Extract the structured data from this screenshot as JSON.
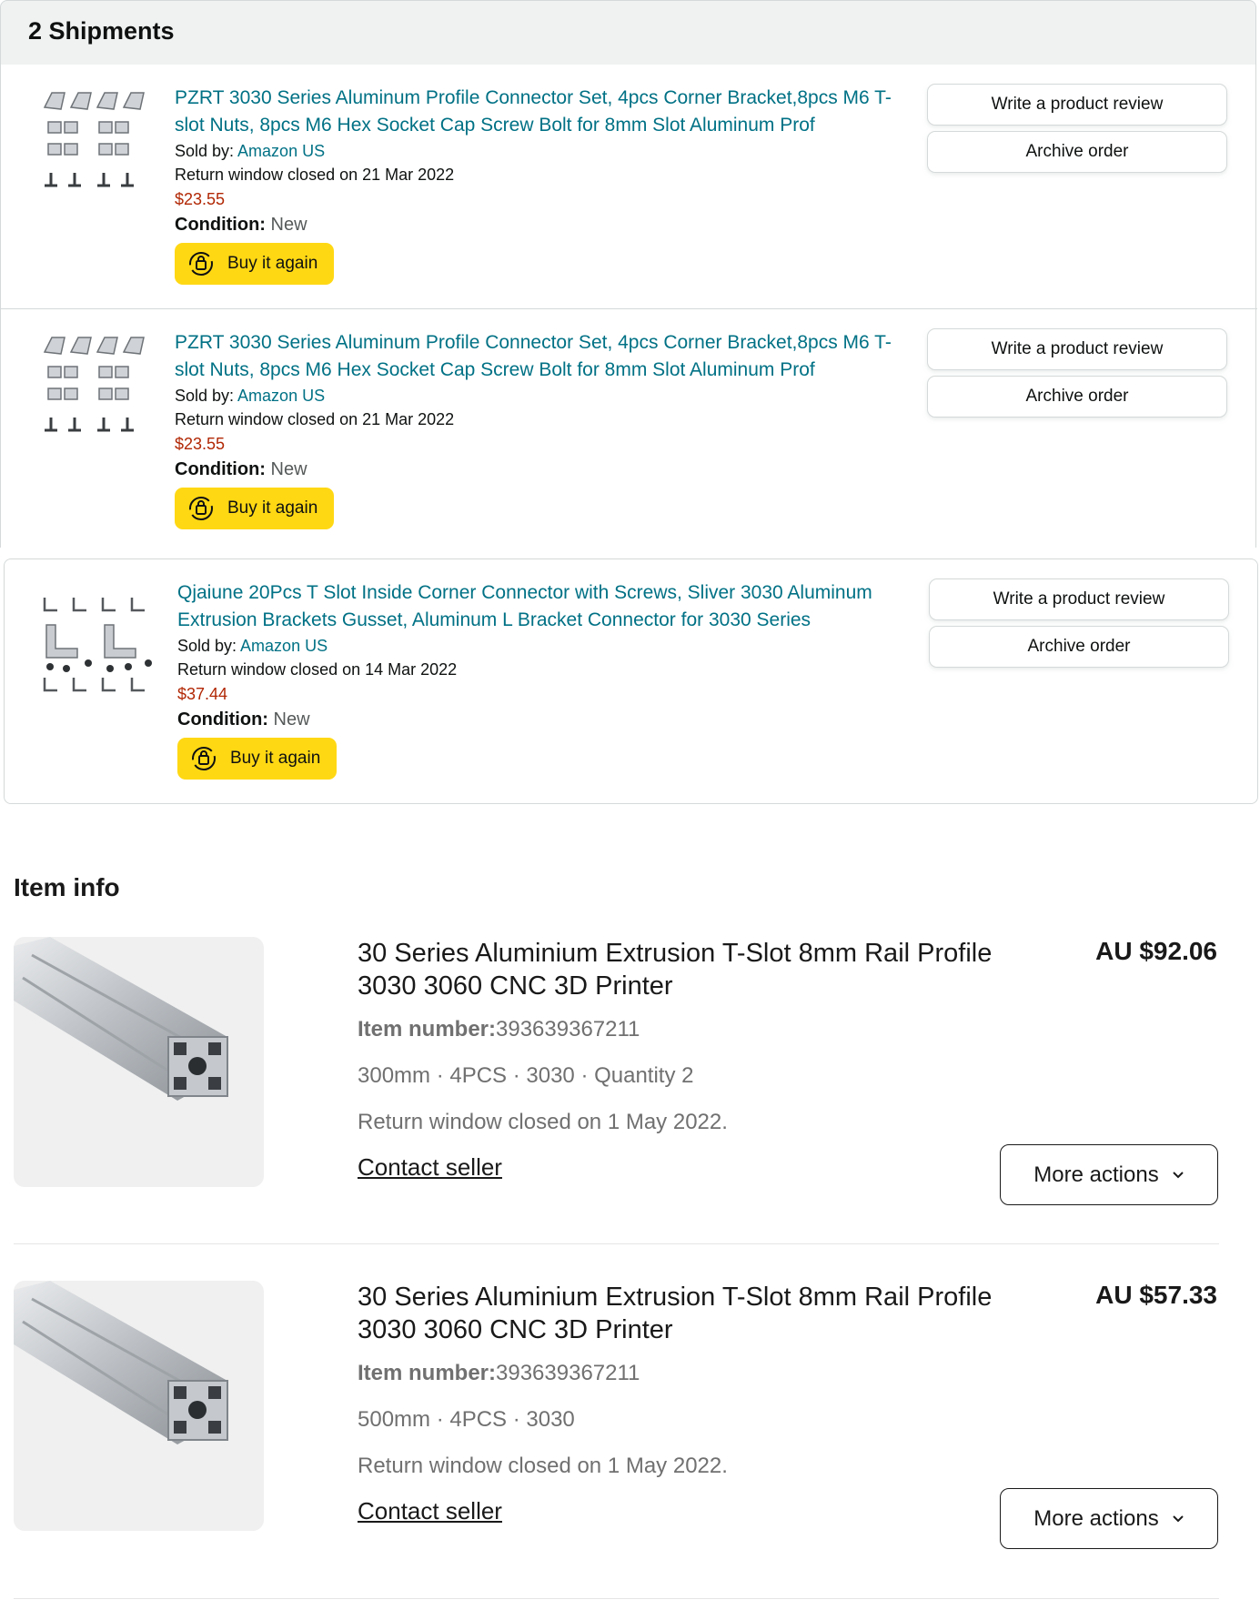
{
  "amazon": {
    "header": {
      "title": "2 Shipments"
    },
    "items": [
      {
        "title": "PZRT 3030 Series Aluminum Profile Connector Set, 4pcs Corner Bracket,8pcs M6 T-slot Nuts, 8pcs M6 Hex Socket Cap Screw Bolt for 8mm Slot Aluminum Prof",
        "sold_by_label": "Sold by: ",
        "seller": "Amazon US",
        "return_text": "Return window closed on 21 Mar 2022",
        "price": "$23.55",
        "condition_label": "Condition:",
        "condition_value": " New",
        "buy_again": "Buy it again",
        "review_button": "Write a product review",
        "archive_button": "Archive order"
      },
      {
        "title": "PZRT 3030 Series Aluminum Profile Connector Set, 4pcs Corner Bracket,8pcs M6 T-slot Nuts, 8pcs M6 Hex Socket Cap Screw Bolt for 8mm Slot Aluminum Prof",
        "sold_by_label": "Sold by: ",
        "seller": "Amazon US",
        "return_text": "Return window closed on 21 Mar 2022",
        "price": "$23.55",
        "condition_label": "Condition:",
        "condition_value": " New",
        "buy_again": "Buy it again",
        "review_button": "Write a product review",
        "archive_button": "Archive order"
      },
      {
        "title": "Qjaiune 20Pcs T Slot Inside Corner Connector with Screws, Sliver 3030 Aluminum Extrusion Brackets Gusset, Aluminum L Bracket Connector for 3030 Series",
        "sold_by_label": "Sold by: ",
        "seller": "Amazon US",
        "return_text": "Return window closed on 14 Mar 2022",
        "price": "$37.44",
        "condition_label": "Condition:",
        "condition_value": " New",
        "buy_again": "Buy it again",
        "review_button": "Write a product review",
        "archive_button": "Archive order"
      }
    ]
  },
  "ebay": {
    "heading": "Item info",
    "items": [
      {
        "title": "30 Series Aluminium Extrusion T-Slot 8mm Rail Profile 3030 3060 CNC 3D Printer",
        "price": "AU $92.06",
        "item_number_label": "Item number:",
        "item_number": "393639367211",
        "variant": "300mm · 4PCS · 3030 · Quantity 2",
        "return_text": "Return window closed on 1 May 2022.",
        "contact": "Contact seller",
        "more_actions": "More actions"
      },
      {
        "title": "30 Series Aluminium Extrusion T-Slot 8mm Rail Profile 3030 3060 CNC 3D Printer",
        "price": "AU $57.33",
        "item_number_label": "Item number:",
        "item_number": "393639367211",
        "variant": "500mm · 4PCS · 3030",
        "return_text": "Return window closed on 1 May 2022.",
        "contact": "Contact seller",
        "more_actions": "More actions"
      }
    ]
  },
  "colors": {
    "amazon_link": "#007185",
    "amazon_price": "#b12704",
    "amazon_buy_button": "#ffd814",
    "header_bg": "#f0f2f2"
  },
  "icons": [
    "reorder-cycle-icon",
    "chevron-down-icon"
  ]
}
